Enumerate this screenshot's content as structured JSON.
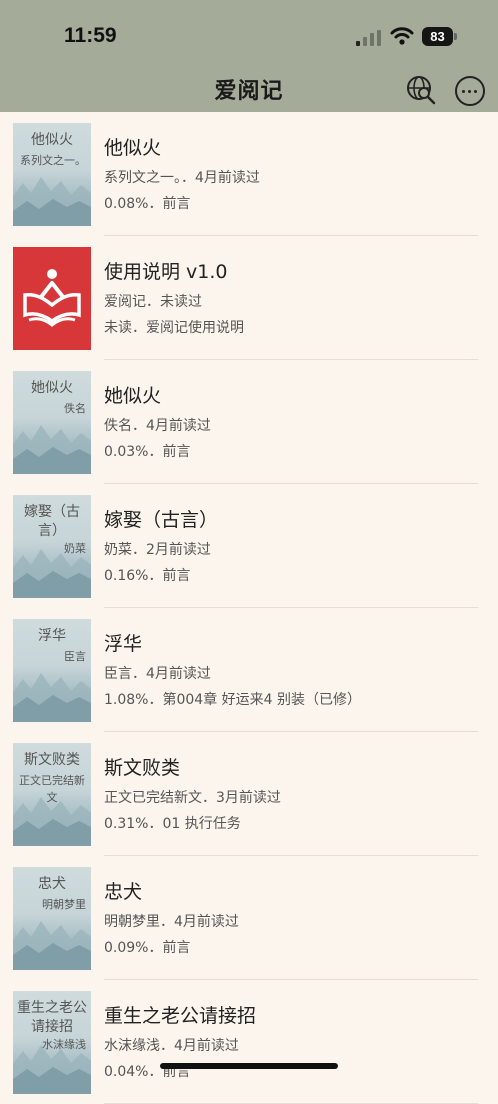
{
  "status": {
    "time": "11:59",
    "battery": "83"
  },
  "header": {
    "title": "爱阅记"
  },
  "books": [
    {
      "title": "他似火",
      "line1": "系列文之一。．4月前读过",
      "line2": "0.08%．前言",
      "cover_title": "他似火",
      "cover_author": "系列文之一。"
    },
    {
      "title": "使用说明 v1.0",
      "line1": "爱阅记．未读过",
      "line2": "未读．爱阅记使用说明",
      "cover_title": "",
      "cover_author": ""
    },
    {
      "title": "她似火",
      "line1": "佚名．4月前读过",
      "line2": "0.03%．前言",
      "cover_title": "她似火",
      "cover_author": "佚名"
    },
    {
      "title": "嫁娶（古言）",
      "line1": "奶菜．2月前读过",
      "line2": "0.16%．前言",
      "cover_title": "嫁娶（古言）",
      "cover_author": "奶菜"
    },
    {
      "title": "浮华",
      "line1": "臣言．4月前读过",
      "line2": "1.08%．第004章 好运来4 别装（已修）",
      "cover_title": "浮华",
      "cover_author": "臣言"
    },
    {
      "title": "斯文败类",
      "line1": "正文已完结新文．3月前读过",
      "line2": "0.31%．01 执行任务",
      "cover_title": "斯文败类",
      "cover_author": "正文已完结新文"
    },
    {
      "title": "忠犬",
      "line1": "明朝梦里．4月前读过",
      "line2": "0.09%．前言",
      "cover_title": "忠犬",
      "cover_author": "明朝梦里"
    },
    {
      "title": "重生之老公请接招",
      "line1": "水沫缘浅．4月前读过",
      "line2": "0.04%．前言",
      "cover_title": "重生之老公请接招",
      "cover_author": "水沫缘浅"
    }
  ]
}
